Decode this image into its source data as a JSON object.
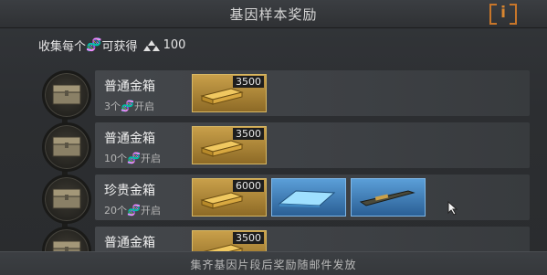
{
  "window": {
    "title": "基因样本奖励",
    "info_label": "i"
  },
  "collect": {
    "prefix": "收集每个",
    "middle": "可获得",
    "amount": "100"
  },
  "rewards": [
    {
      "name": "普通金箱",
      "req_count": "3个",
      "req_suffix": "开启",
      "items": [
        {
          "type": "gold-bars",
          "qty": "3500"
        }
      ]
    },
    {
      "name": "普通金箱",
      "req_count": "10个",
      "req_suffix": "开启",
      "items": [
        {
          "type": "gold-bars",
          "qty": "3500"
        }
      ]
    },
    {
      "name": "珍贵金箱",
      "req_count": "20个",
      "req_suffix": "开启",
      "items": [
        {
          "type": "gold-bars",
          "qty": "6000"
        },
        {
          "type": "blue-crystal-plate"
        },
        {
          "type": "weapon-blueprint"
        }
      ]
    },
    {
      "name": "普通金箱",
      "req_count": "",
      "req_suffix": "",
      "items": [
        {
          "type": "gold-bars",
          "qty": "3500"
        }
      ]
    }
  ],
  "footer": {
    "text": "集齐基因片段后奖励随邮件发放"
  },
  "colors": {
    "gold_item": "#c9a04a",
    "blue_item": "#5b9fd8",
    "dna_icon": "#6aa7e0",
    "info_accent": "#d98630"
  }
}
